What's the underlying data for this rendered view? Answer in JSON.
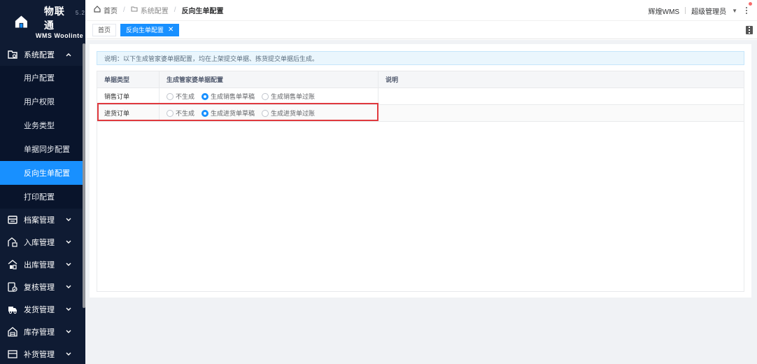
{
  "brand": {
    "name": "物联通",
    "version": "5.2",
    "subtitle": "WMS Woolinte"
  },
  "sidebar": {
    "groups": [
      {
        "label": "系统配置",
        "icon": "folder-settings-icon",
        "expanded": true,
        "items": [
          {
            "label": "用户配置"
          },
          {
            "label": "用户权限"
          },
          {
            "label": "业务类型"
          },
          {
            "label": "单据同步配置"
          },
          {
            "label": "反向生单配置",
            "active": true
          },
          {
            "label": "打印配置"
          }
        ]
      },
      {
        "label": "档案管理",
        "icon": "archive-icon"
      },
      {
        "label": "入库管理",
        "icon": "inbound-icon"
      },
      {
        "label": "出库管理",
        "icon": "outbound-icon"
      },
      {
        "label": "复核管理",
        "icon": "review-icon"
      },
      {
        "label": "发货管理",
        "icon": "truck-icon"
      },
      {
        "label": "库存管理",
        "icon": "warehouse-icon"
      },
      {
        "label": "补货管理",
        "icon": "replenish-icon"
      }
    ]
  },
  "breadcrumb": {
    "home": "首页",
    "section": "系统配置",
    "current": "反向生单配置"
  },
  "header": {
    "org": "辉煌WMS",
    "user": "超级管理员"
  },
  "tabs": [
    {
      "label": "首页",
      "active": false
    },
    {
      "label": "反向生单配置",
      "active": true,
      "close": "✕"
    }
  ],
  "notice": "说明：以下生成管家婆单据配置，均在上架提交单据、拣货提交单据后生成。",
  "table": {
    "columns": [
      "单据类型",
      "生成管家婆单据配置",
      "说明"
    ],
    "rows": [
      {
        "type": "销售订单",
        "options": [
          "不生成",
          "生成销售单草稿",
          "生成销售单过账"
        ],
        "selected": 1,
        "note": ""
      },
      {
        "type": "进货订单",
        "options": [
          "不生成",
          "生成进货单草稿",
          "生成进货单过账"
        ],
        "selected": 1,
        "note": ""
      }
    ]
  },
  "colors": {
    "sidebar_bg": "#0f1b33",
    "accent": "#1890ff",
    "highlight": "#e0393e"
  }
}
